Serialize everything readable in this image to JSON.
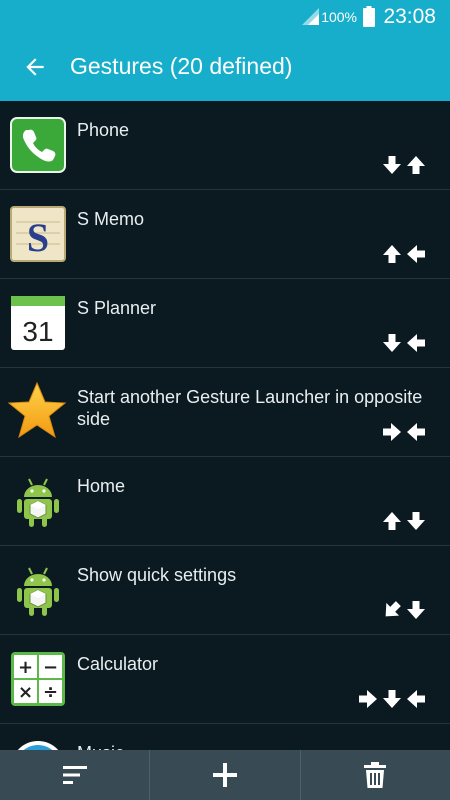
{
  "status_bar": {
    "battery_percent": "100%",
    "time": "23:08"
  },
  "header": {
    "title": "Gestures (20 defined)",
    "accent_color": "#17aecb"
  },
  "gestures": [
    {
      "label": "Phone",
      "icon": "phone-icon",
      "gesture": [
        "down",
        "up"
      ]
    },
    {
      "label": "S Memo",
      "icon": "s-memo-icon",
      "gesture": [
        "up",
        "left"
      ]
    },
    {
      "label": "S Planner",
      "icon": "s-planner-icon",
      "icon_text": "31",
      "gesture": [
        "down",
        "left"
      ]
    },
    {
      "label": "Start another Gesture Launcher in opposite side",
      "icon": "star-icon",
      "gesture": [
        "right",
        "left"
      ]
    },
    {
      "label": "Home",
      "icon": "android-icon",
      "gesture": [
        "up",
        "down"
      ]
    },
    {
      "label": "Show quick settings",
      "icon": "android-icon",
      "gesture": [
        "down-left",
        "down"
      ]
    },
    {
      "label": "Calculator",
      "icon": "calculator-icon",
      "gesture": [
        "right",
        "down",
        "left"
      ]
    },
    {
      "label": "Music",
      "icon": "music-icon",
      "gesture": []
    }
  ],
  "bottom_bar": [
    {
      "icon": "sort-icon"
    },
    {
      "icon": "add-icon"
    },
    {
      "icon": "delete-icon"
    }
  ]
}
